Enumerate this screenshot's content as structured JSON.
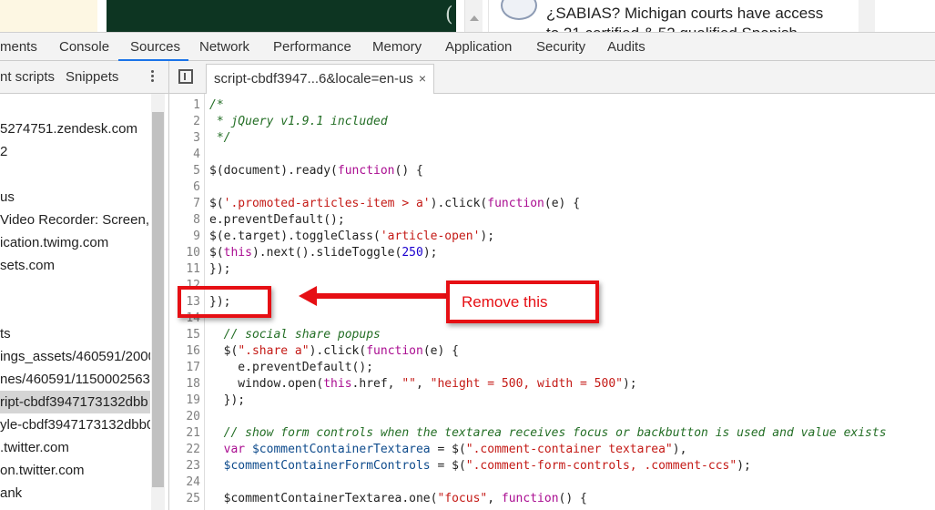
{
  "webpage": {
    "headline_line1": "¿SABIAS? Michigan courts have access",
    "headline_line2": "to 21 certified & 52 qualified Spanish"
  },
  "devtools": {
    "main_tabs": [
      {
        "label": "ments"
      },
      {
        "label": "Console"
      },
      {
        "label": "Sources"
      },
      {
        "label": "Network"
      },
      {
        "label": "Performance"
      },
      {
        "label": "Memory"
      },
      {
        "label": "Application"
      },
      {
        "label": "Security"
      },
      {
        "label": "Audits"
      }
    ],
    "active_tab": "Sources",
    "sources_subtabs": [
      {
        "label": "nt scripts"
      },
      {
        "label": "Snippets"
      }
    ],
    "file_tree": [
      {
        "label": "5274751.zendesk.com"
      },
      {
        "label": "2"
      },
      {
        "label": ""
      },
      {
        "label": "us"
      },
      {
        "label": "Video Recorder: Screen, W"
      },
      {
        "label": "ication.twimg.com"
      },
      {
        "label": "sets.com"
      },
      {
        "label": ""
      },
      {
        "label": ""
      },
      {
        "label": "ts"
      },
      {
        "label": "ings_assets/460591/2000"
      },
      {
        "label": "nes/460591/1150002563"
      },
      {
        "label": "ript-cbdf3947173132dbb"
      },
      {
        "label": "yle-cbdf3947173132dbb0"
      },
      {
        "label": ".twitter.com"
      },
      {
        "label": "on.twitter.com"
      },
      {
        "label": "ank"
      }
    ],
    "selected_file_index": 12,
    "editor_tab": {
      "label": "script-cbdf3947...6&locale=en-us",
      "close_glyph": "×"
    }
  },
  "code": {
    "line_numbers": [
      "1",
      "2",
      "3",
      "4",
      "5",
      "6",
      "7",
      "8",
      "9",
      "10",
      "11",
      "12",
      "13",
      "14",
      "15",
      "16",
      "17",
      "18",
      "19",
      "20",
      "21",
      "22",
      "23",
      "24",
      "25"
    ],
    "lines": [
      [
        {
          "t": "/*",
          "c": "comment"
        }
      ],
      [
        {
          "t": " * jQuery v1.9.1 included",
          "c": "comment"
        }
      ],
      [
        {
          "t": " */",
          "c": "comment"
        }
      ],
      [],
      [
        {
          "t": "$(document).ready(",
          "c": "plain"
        },
        {
          "t": "function",
          "c": "keyword"
        },
        {
          "t": "() {",
          "c": "plain"
        }
      ],
      [],
      [
        {
          "t": "$(",
          "c": "plain"
        },
        {
          "t": "'.promoted-articles-item > a'",
          "c": "string"
        },
        {
          "t": ").click(",
          "c": "plain"
        },
        {
          "t": "function",
          "c": "keyword"
        },
        {
          "t": "(e) {",
          "c": "plain"
        }
      ],
      [
        {
          "t": "e.preventDefault();",
          "c": "plain"
        }
      ],
      [
        {
          "t": "$(e.target).toggleClass(",
          "c": "plain"
        },
        {
          "t": "'article-open'",
          "c": "string"
        },
        {
          "t": ");",
          "c": "plain"
        }
      ],
      [
        {
          "t": "$(",
          "c": "plain"
        },
        {
          "t": "this",
          "c": "keyword"
        },
        {
          "t": ").next().slideToggle(",
          "c": "plain"
        },
        {
          "t": "250",
          "c": "number"
        },
        {
          "t": ");",
          "c": "plain"
        }
      ],
      [
        {
          "t": "});",
          "c": "plain"
        }
      ],
      [],
      [
        {
          "t": "});",
          "c": "plain"
        }
      ],
      [],
      [
        {
          "t": "  ",
          "c": "plain"
        },
        {
          "t": "// social share popups",
          "c": "comment"
        }
      ],
      [
        {
          "t": "  $(",
          "c": "plain"
        },
        {
          "t": "\".share a\"",
          "c": "string"
        },
        {
          "t": ").click(",
          "c": "plain"
        },
        {
          "t": "function",
          "c": "keyword"
        },
        {
          "t": "(e) {",
          "c": "plain"
        }
      ],
      [
        {
          "t": "    e.preventDefault();",
          "c": "plain"
        }
      ],
      [
        {
          "t": "    window.open(",
          "c": "plain"
        },
        {
          "t": "this",
          "c": "keyword"
        },
        {
          "t": ".href, ",
          "c": "plain"
        },
        {
          "t": "\"\"",
          "c": "string"
        },
        {
          "t": ", ",
          "c": "plain"
        },
        {
          "t": "\"height = 500, width = 500\"",
          "c": "string"
        },
        {
          "t": ");",
          "c": "plain"
        }
      ],
      [
        {
          "t": "  });",
          "c": "plain"
        }
      ],
      [],
      [
        {
          "t": "  ",
          "c": "plain"
        },
        {
          "t": "// show form controls when the textarea receives focus or backbutton is used and value exists",
          "c": "comment"
        }
      ],
      [
        {
          "t": "  ",
          "c": "plain"
        },
        {
          "t": "var",
          "c": "keyword"
        },
        {
          "t": " ",
          "c": "plain"
        },
        {
          "t": "$commentContainerTextarea",
          "c": "var"
        },
        {
          "t": " = $(",
          "c": "plain"
        },
        {
          "t": "\".comment-container textarea\"",
          "c": "string"
        },
        {
          "t": "),",
          "c": "plain"
        }
      ],
      [
        {
          "t": "  ",
          "c": "plain"
        },
        {
          "t": "$commentContainerFormControls",
          "c": "var"
        },
        {
          "t": " = $(",
          "c": "plain"
        },
        {
          "t": "\".comment-form-controls, .comment-ccs\"",
          "c": "string"
        },
        {
          "t": ");",
          "c": "plain"
        }
      ],
      [],
      [
        {
          "t": "  $commentContainerTextarea.one(",
          "c": "plain"
        },
        {
          "t": "\"focus\"",
          "c": "string"
        },
        {
          "t": ", ",
          "c": "plain"
        },
        {
          "t": "function",
          "c": "keyword"
        },
        {
          "t": "() {",
          "c": "plain"
        }
      ]
    ]
  },
  "annotation": {
    "callout_text": "Remove this",
    "color": "#e60f14"
  },
  "colors": {
    "accent": "#1a73e8",
    "comment": "#236e25",
    "keyword": "#aa0d91",
    "string": "#c41a16",
    "number": "#1c00cf"
  }
}
